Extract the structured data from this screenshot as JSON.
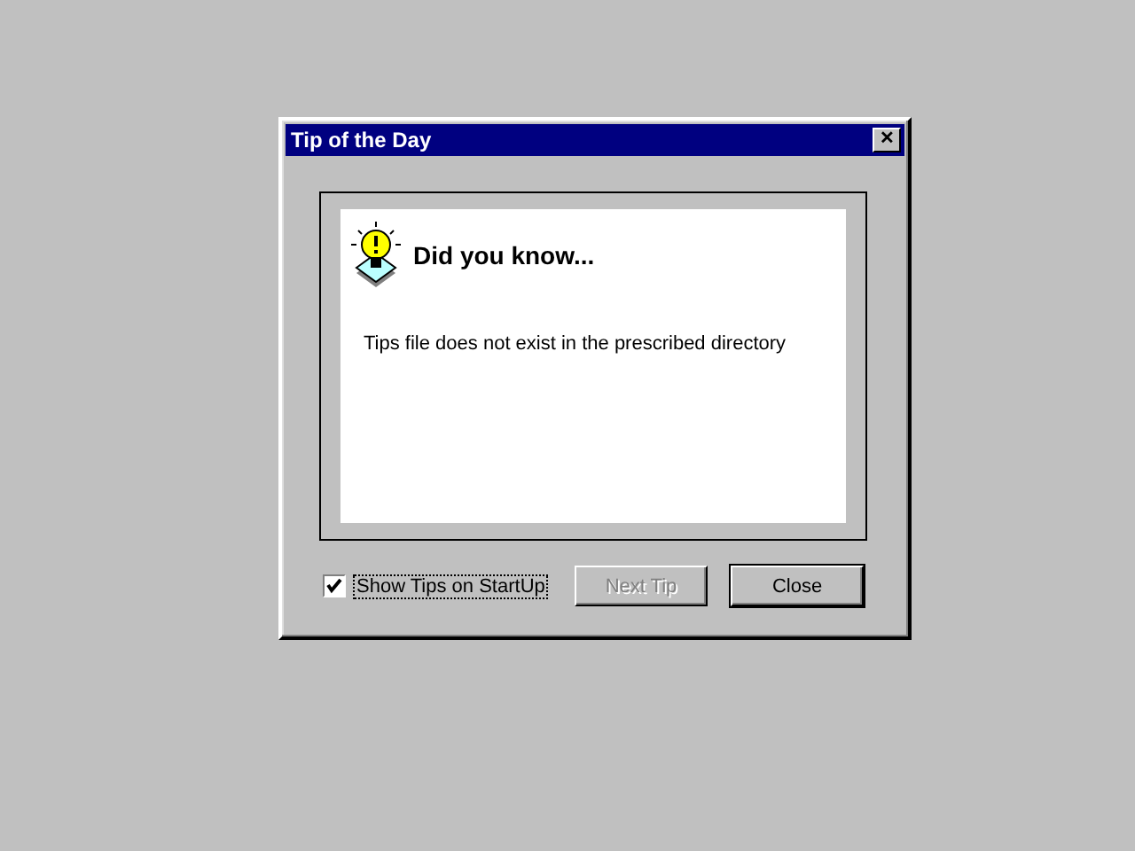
{
  "window": {
    "title": "Tip of the Day",
    "close": "✕"
  },
  "tip": {
    "heading": "Did you know...",
    "text": "Tips file does not exist in the prescribed directory"
  },
  "show_tips": {
    "label": "Show Tips on StartUp",
    "checked": true
  },
  "buttons": [
    {
      "label": "Next Tip",
      "disabled": true,
      "default": false
    },
    {
      "label": "Close",
      "disabled": false,
      "default": true
    }
  ]
}
